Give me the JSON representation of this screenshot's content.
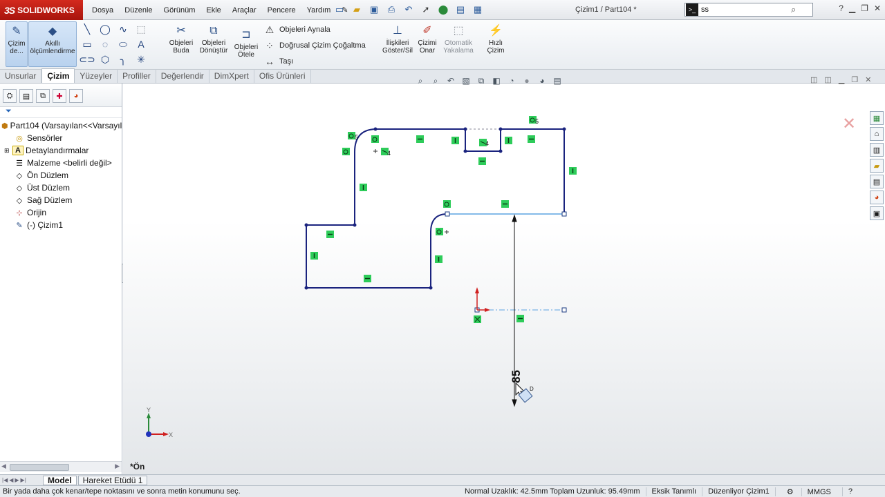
{
  "app": {
    "brand": "SOLIDWORKS",
    "brand_mark": "3S",
    "document_title": "Çizim1 / Part104 *"
  },
  "menu": [
    "Dosya",
    "Düzenle",
    "Görünüm",
    "Ekle",
    "Araçlar",
    "Pencere",
    "Yardım"
  ],
  "search": {
    "value": "ss",
    "cmd_icon": ">_"
  },
  "ribbon": {
    "sketch_btn": "Çizim de...",
    "smart_dim_btn": "Akıllı ölçümlendirme",
    "trim_btn": "Objeleri Buda",
    "convert_btn": "Objeleri Dönüştür",
    "offset_btn": "Objeleri Ötele",
    "mirror": "Objeleri Aynala",
    "linear_pattern": "Doğrusal Çizim Çoğaltma",
    "move": "Taşı",
    "relations_btn": "İlişkileri Göster/Sil",
    "repair_btn": "Çizimi Onar",
    "snap_btn": "Otomatik Yakalama",
    "rapid_btn": "Hızlı Çizim"
  },
  "tabs": [
    "Unsurlar",
    "Çizim",
    "Yüzeyler",
    "Profiller",
    "Değerlendir",
    "DimXpert",
    "Ofis Ürünleri"
  ],
  "active_tab": "Çizim",
  "tree": {
    "root": "Part104  (Varsayılan<<Varsayılan",
    "items": [
      {
        "label": "Sensörler",
        "icon": "sensor-icon"
      },
      {
        "label": "Detaylandırmalar",
        "icon": "annotation-icon"
      },
      {
        "label": "Malzeme <belirli değil>",
        "icon": "material-icon"
      },
      {
        "label": "Ön Düzlem",
        "icon": "plane-icon"
      },
      {
        "label": "Üst Düzlem",
        "icon": "plane-icon"
      },
      {
        "label": "Sağ Düzlem",
        "icon": "plane-icon"
      },
      {
        "label": "Orijin",
        "icon": "origin-icon"
      },
      {
        "label": "(-) Çizim1",
        "icon": "sketch-icon"
      }
    ]
  },
  "graphics": {
    "view_label": "*Ön",
    "dimension_value": "85",
    "relation_labels": [
      "5",
      "4",
      "4"
    ],
    "axis_labels": {
      "x": "X",
      "y": "Y"
    },
    "cursor_tag": "D"
  },
  "bottom_tabs": [
    "Model",
    "Hareket Etüdü 1"
  ],
  "status": {
    "message": "Bir yada daha çok kenar/tepe noktasını ve sonra metin konumunu seç.",
    "normal_distance": "Normal Uzaklık: 42.5mm Toplam Uzunluk: 95.49mm",
    "defined_state": "Eksik Tanımlı",
    "editing": "Düzenliyor Çizim1",
    "units": "MMGS"
  },
  "colors": {
    "sketch_line": "#1a237e",
    "selected_line": "#5ba3e0",
    "relation_fill": "#2ecc5a",
    "brand_red": "#c0201a"
  }
}
